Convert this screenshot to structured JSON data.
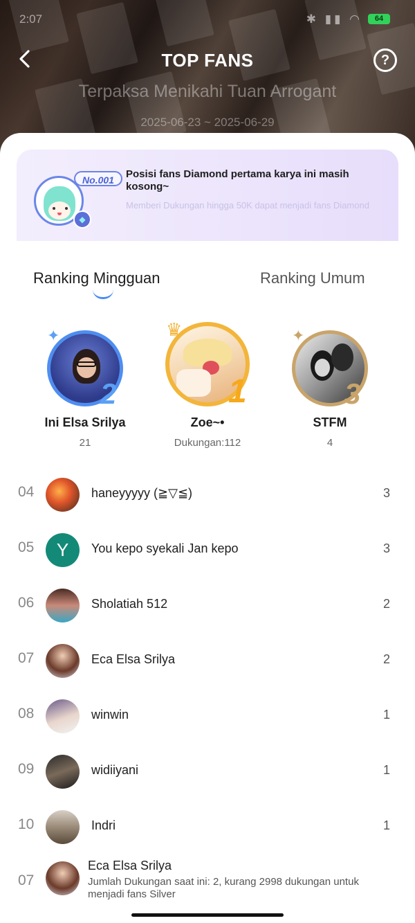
{
  "status_bar": {
    "time": "2:07",
    "battery": "64"
  },
  "header": {
    "title": "TOP FANS",
    "book_title": "Terpaksa Menikahi Tuan Arrogant",
    "date_range": "2025-06-23 ~ 2025-06-29"
  },
  "banner": {
    "badge": "No.001",
    "title": "Posisi fans Diamond pertama karya ini masih kosong~",
    "subtitle": "Memberi Dukungan hingga 50K dapat menjadi fans Diamond"
  },
  "tabs": [
    {
      "label": "Ranking Mingguan",
      "active": true
    },
    {
      "label": "Ranking Umum",
      "active": false
    }
  ],
  "podium": [
    {
      "rank": "2",
      "name": "Ini Elsa Srilya",
      "value": "21",
      "ring_color": "#4f8ef0"
    },
    {
      "rank": "1",
      "name": "Zoe~•",
      "value": "Dukungan:112",
      "ring_color": "#f3b53a"
    },
    {
      "rank": "3",
      "name": "STFM",
      "value": "4",
      "ring_color": "#c9a46a"
    }
  ],
  "ranking": [
    {
      "rank": "04",
      "name": "haneyyyyy (≧▽≦)",
      "value": "3"
    },
    {
      "rank": "05",
      "name": "You kepo syekali Jan kepo",
      "value": "3",
      "initial": "Y"
    },
    {
      "rank": "06",
      "name": "Sholatiah 512",
      "value": "2"
    },
    {
      "rank": "07",
      "name": "Eca Elsa Srilya",
      "value": "2"
    },
    {
      "rank": "08",
      "name": "winwin",
      "value": "1"
    },
    {
      "rank": "09",
      "name": "widiiyani",
      "value": "1"
    },
    {
      "rank": "10",
      "name": "Indri",
      "value": "1"
    }
  ],
  "current_user": {
    "rank": "07",
    "name": "Eca Elsa Srilya",
    "description": "Jumlah Dukungan saat ini: 2, kurang 2998 dukungan untuk menjadi fans Silver"
  }
}
